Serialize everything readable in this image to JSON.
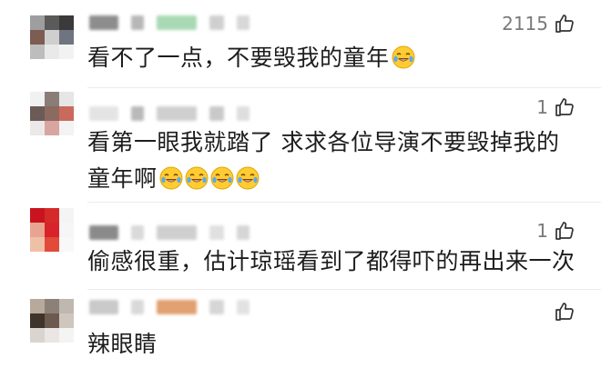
{
  "comments": [
    {
      "text": "看不了一点，不要毁我的童年",
      "likes": "2115",
      "emoji_count": 1,
      "avatar_colors": [
        "#9e9e9e",
        "#5a5a5a",
        "#3a3a3a",
        "#7d5c52",
        "#cfcfcf",
        "#6e7480",
        "#bdbdbd",
        "#e9e9e9",
        "#f2f2f2"
      ],
      "name_blocks": [
        "#8d8d8d",
        "#b7b7b7",
        "#a9d9b4",
        "#cfcfcf",
        "#d8d8d8"
      ]
    },
    {
      "text": "看第一眼我就踏了 求求各位导演不要毁掉我的童年啊",
      "likes": "1",
      "emoji_count": 4,
      "avatar_colors": [
        "#f1f1f1",
        "#8a7d78",
        "#e6e6e6",
        "#6b5b56",
        "#8c6a60",
        "#c96a5c",
        "#ece8e8",
        "#d9a5a0",
        "#f3f3f3"
      ],
      "name_blocks": [
        "#e4e4e4",
        "#b9b9b9",
        "#cfcfcf",
        "#c9c9c9",
        "#dedede"
      ]
    },
    {
      "text": "偷感很重，估计琼瑶看到了都得吓的再出来一次",
      "likes": "1",
      "emoji_count": 0,
      "avatar_colors": [
        "#c9141f",
        "#d62a2a",
        "#f4f4f4",
        "#e7a490",
        "#d8232a",
        "#f6f6f6",
        "#f0c0a6",
        "#e24a3a",
        "#f8f8f8"
      ],
      "name_blocks": [
        "#8a8a8a",
        "#d9d9d9",
        "#cfcfcf",
        "#e0e0e0",
        "#d6d6d6"
      ]
    },
    {
      "text": "辣眼睛",
      "likes": "",
      "emoji_count": 0,
      "avatar_colors": [
        "#b7a99b",
        "#8c8177",
        "#bfb8b0",
        "#3e342c",
        "#6b5a4d",
        "#cfc6bd",
        "#d9d4cf",
        "#e9e6e3",
        "#f4f4f4"
      ],
      "name_blocks": [
        "#c9c9c9",
        "#d9d9d9",
        "#e0a070",
        "#d6d6d6",
        "#e2e2e2"
      ]
    }
  ]
}
